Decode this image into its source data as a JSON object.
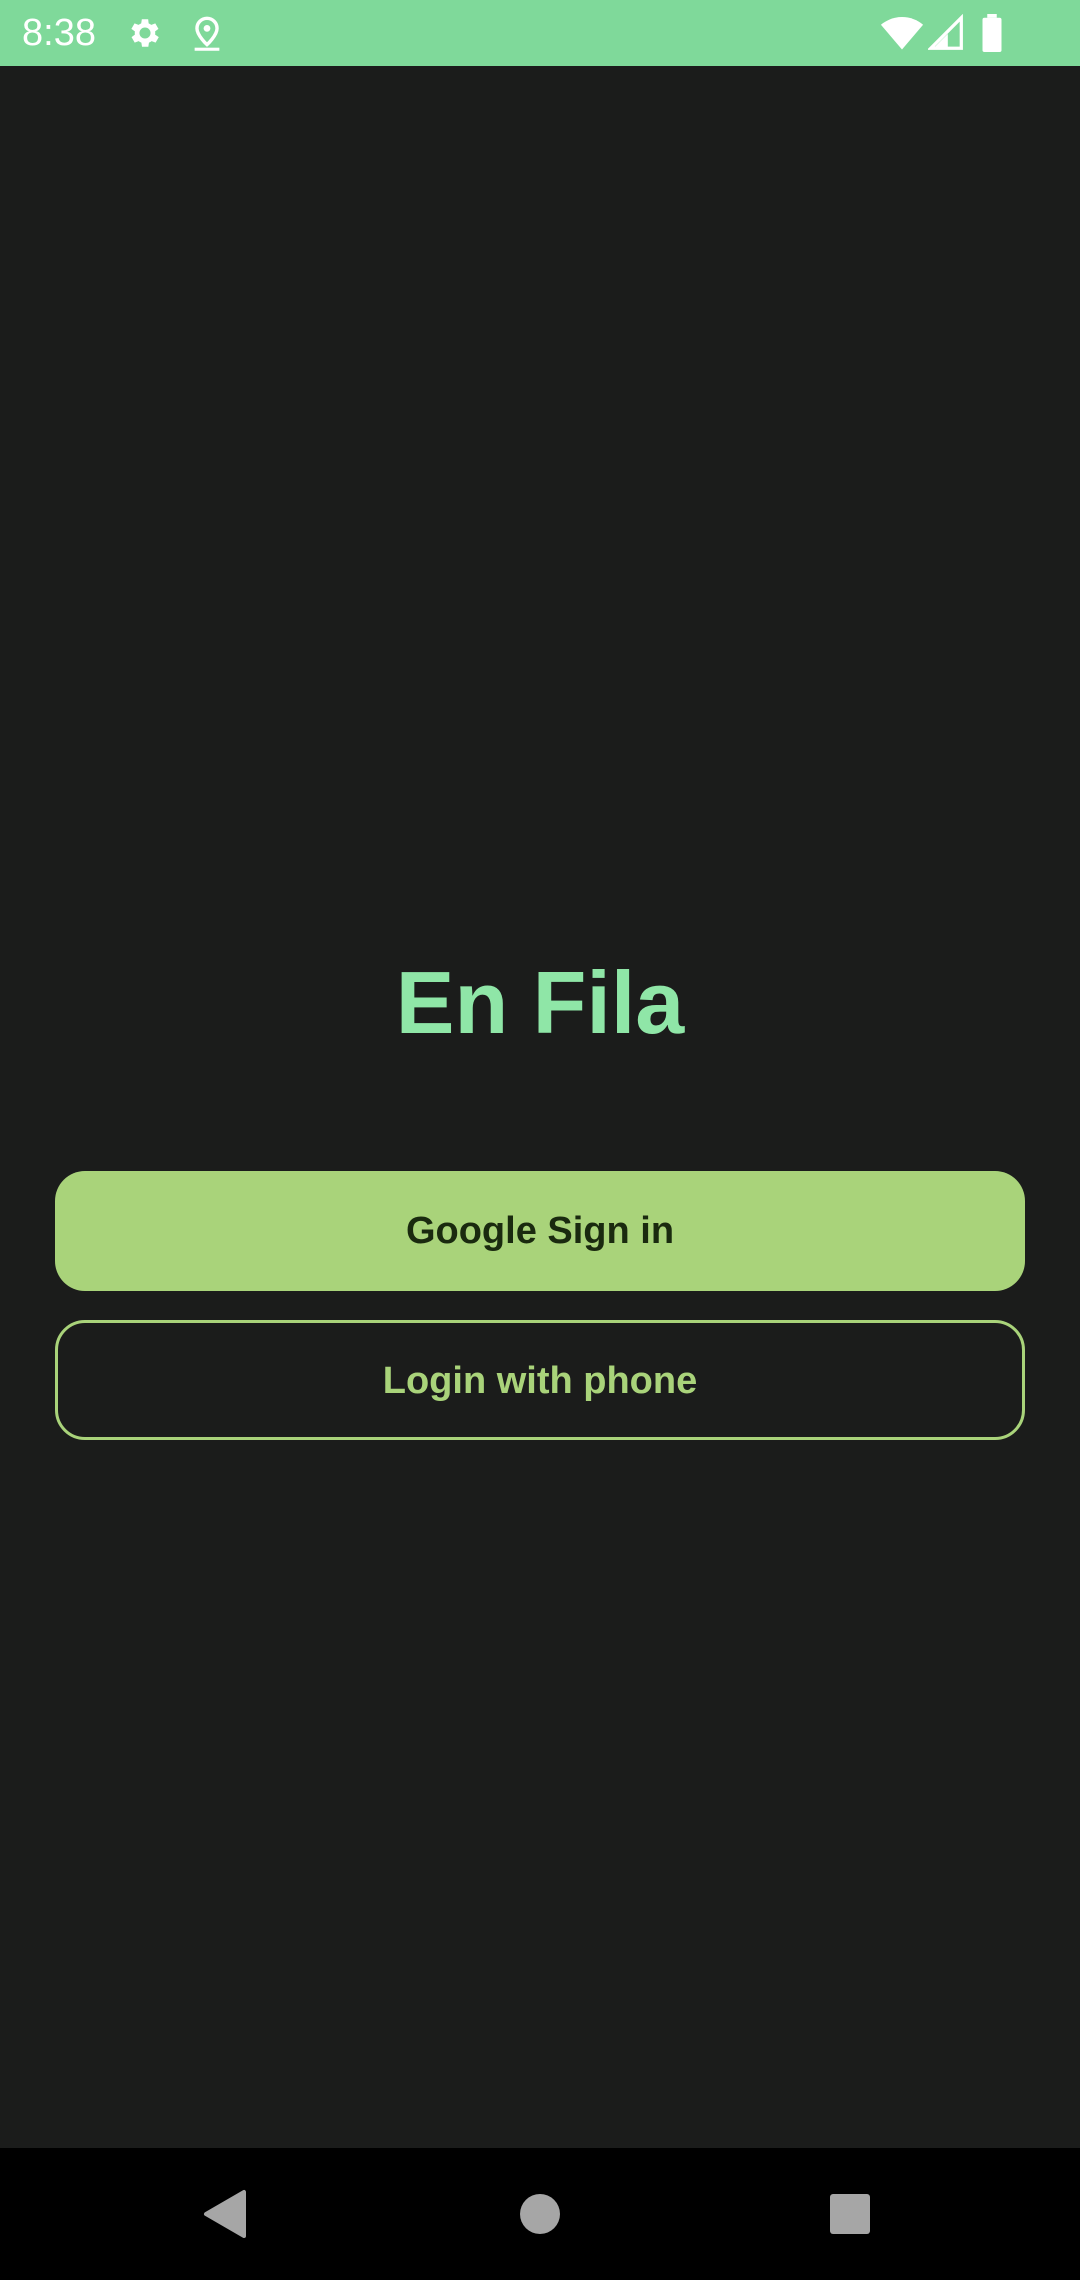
{
  "status_bar": {
    "time": "8:38",
    "background": "#7fd99a",
    "icons_left": [
      "gear-icon",
      "location-pin-icon"
    ],
    "icons_right": [
      "wifi-icon",
      "cellular-signal-icon",
      "battery-icon"
    ]
  },
  "app": {
    "title": "En Fila",
    "title_color": "#8fe6a7",
    "background": "#1b1c1b"
  },
  "buttons": {
    "google_label": "Google Sign in",
    "phone_label": "Login with phone",
    "accent": "#a9d37a"
  },
  "nav_bar": {
    "items": [
      "back-icon",
      "home-icon",
      "recents-icon"
    ]
  }
}
